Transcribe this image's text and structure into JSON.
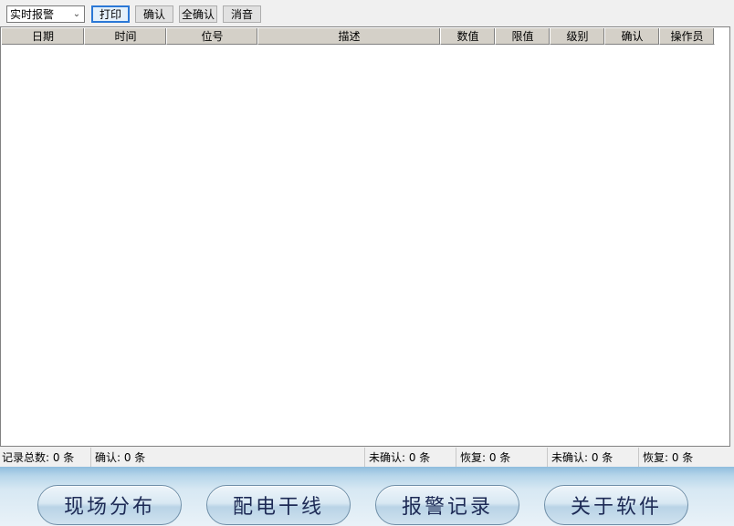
{
  "toolbar": {
    "select_value": "实时报警",
    "print_label": "打印",
    "confirm_label": "确认",
    "confirm_all_label": "全确认",
    "mute_label": "消音"
  },
  "table": {
    "columns": [
      "日期",
      "时间",
      "位号",
      "描述",
      "数值",
      "限值",
      "级别",
      "确认",
      "操作员"
    ],
    "rows": []
  },
  "status": {
    "total": "记录总数: 0 条",
    "confirmed": "确认: 0 条",
    "unconfirmed_1": "未确认: 0 条",
    "recovered_1": "恢复: 0 条",
    "unconfirmed_2": "未确认: 0 条",
    "recovered_2": "恢复: 0 条"
  },
  "nav": {
    "site_layout": "现场分布",
    "power_trunk": "配电干线",
    "alarm_log": "报警记录",
    "about": "关于软件"
  },
  "colors": {
    "header_bg": "#d4d0c8",
    "focus_border": "#2b78d6",
    "nav_text": "#1d2a55",
    "nav_bg_top": "#8fbddd"
  }
}
